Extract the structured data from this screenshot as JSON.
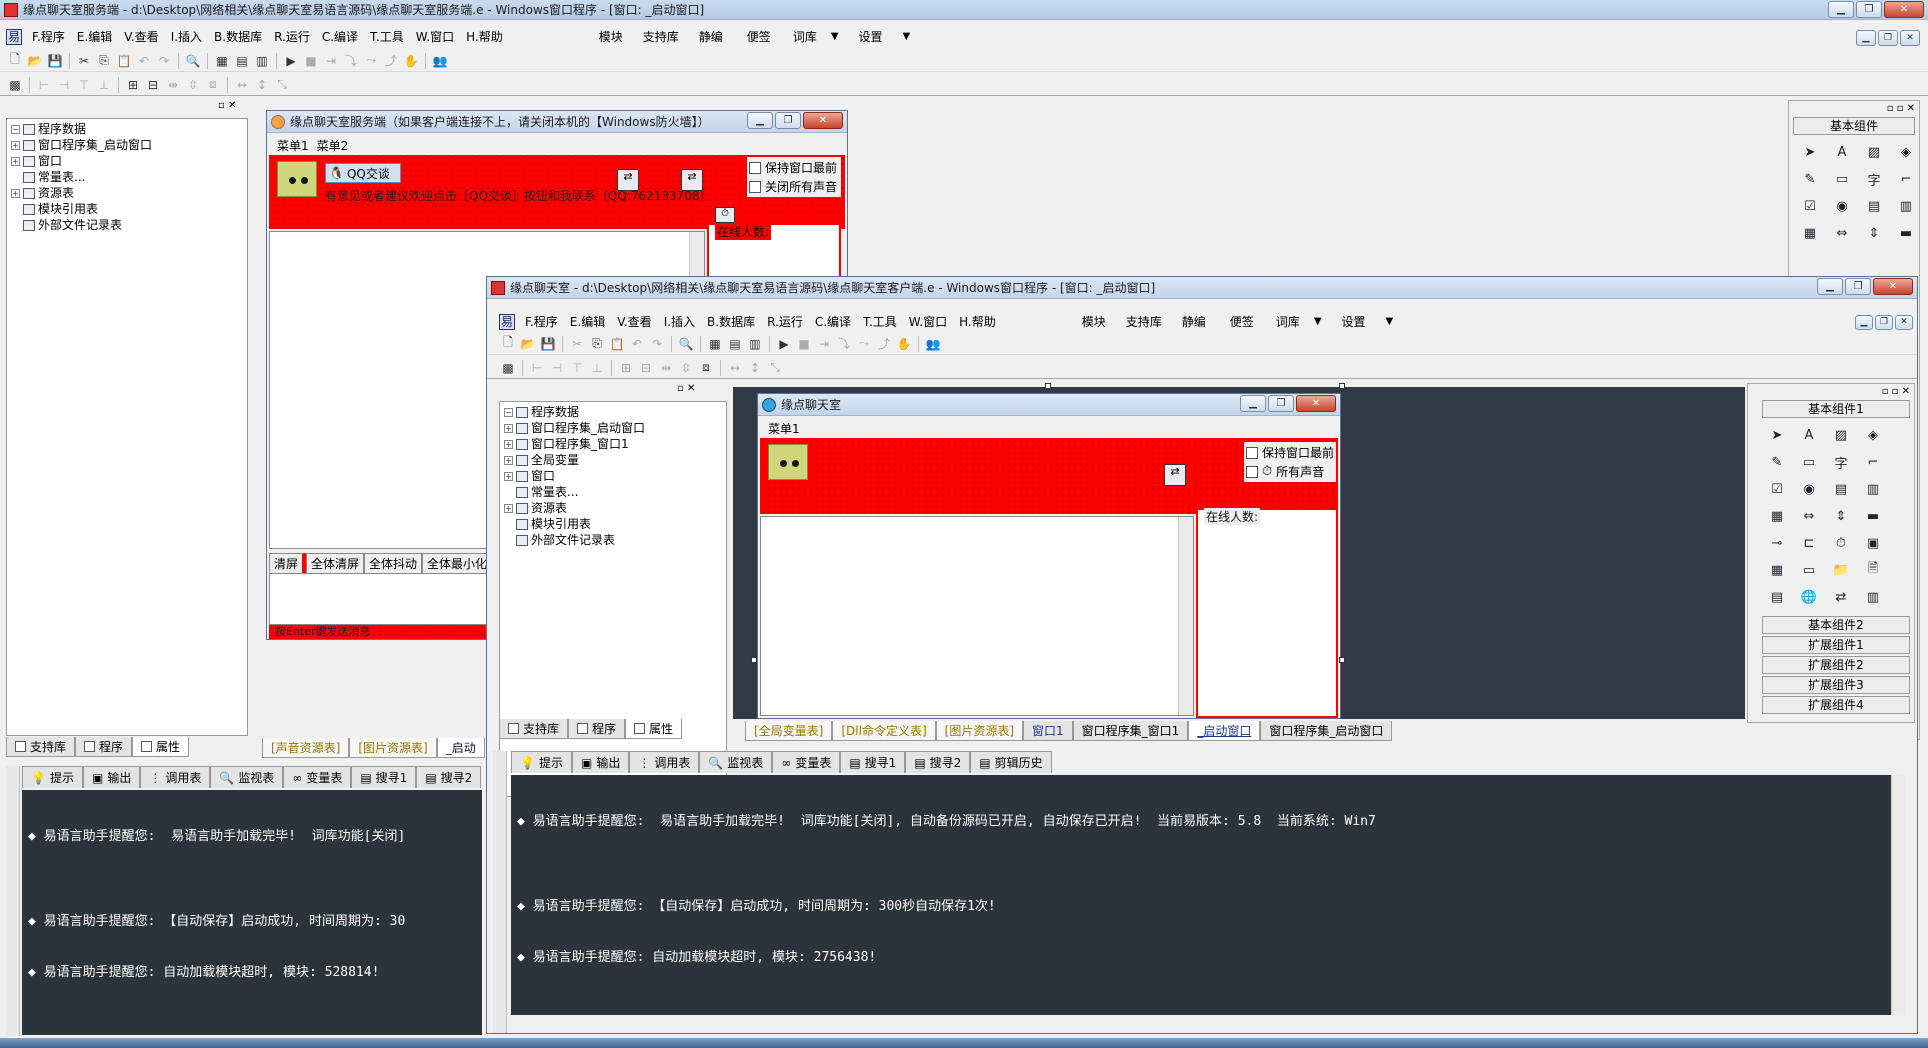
{
  "main_window": {
    "title": "缘点聊天室服务端 - d:\\Desktop\\网络相关\\缘点聊天室易语言源码\\缘点聊天室服务端.e - Windows窗口程序 - [窗口: _启动窗口]",
    "menu": [
      {
        "label": "F.程序"
      },
      {
        "label": "E.编辑"
      },
      {
        "label": "V.查看"
      },
      {
        "label": "I.插入"
      },
      {
        "label": "B.数据库"
      },
      {
        "label": "R.运行"
      },
      {
        "label": "C.编译"
      },
      {
        "label": "T.工具"
      },
      {
        "label": "W.窗口"
      },
      {
        "label": "H.帮助"
      }
    ],
    "menu_extra": [
      {
        "label": "模块"
      },
      {
        "label": "支持库"
      },
      {
        "label": "静编"
      },
      {
        "label": "便签"
      },
      {
        "label": "词库"
      },
      {
        "label": "▼"
      },
      {
        "label": "设置"
      },
      {
        "label": "▼"
      }
    ],
    "tree": [
      {
        "label": "程序数据",
        "level": 0,
        "expander": "−"
      },
      {
        "label": "窗口程序集_启动窗口",
        "level": 1,
        "expander": "+"
      },
      {
        "label": "窗口",
        "level": 1,
        "expander": "+"
      },
      {
        "label": "常量表...",
        "level": 1,
        "expander": ""
      },
      {
        "label": "资源表",
        "level": 1,
        "expander": "+"
      },
      {
        "label": "模块引用表",
        "level": 1,
        "expander": ""
      },
      {
        "label": "外部文件记录表",
        "level": 1,
        "expander": ""
      }
    ],
    "left_tabs": [
      {
        "label": "支持库"
      },
      {
        "label": "程序"
      },
      {
        "label": "属性"
      }
    ],
    "editor_tabs": [
      {
        "label": "[声音资源表]"
      },
      {
        "label": "[图片资源表]"
      },
      {
        "label": "_启动"
      }
    ],
    "output_tabs": [
      {
        "label": "提示"
      },
      {
        "label": "输出"
      },
      {
        "label": "调用表"
      },
      {
        "label": "监视表"
      },
      {
        "label": "变量表"
      },
      {
        "label": "搜寻1"
      },
      {
        "label": "搜寻2"
      }
    ],
    "output_lines": [
      "◆ 易语言助手提醒您:  易语言助手加载完毕!  词库功能[关闭]",
      "",
      "◆ 易语言助手提醒您: 【自动保存】启动成功, 时间周期为: 30",
      "◆ 易语言助手提醒您: 自动加载模块超时, 模块: 528814!"
    ],
    "right_panel": {
      "header": "基本组件",
      "buttons": []
    }
  },
  "server_form": {
    "title": "缘点聊天室服务端（如果客户端连接不上，请关闭本机的【Windows防火墙】）",
    "menu": [
      {
        "label": "菜单1"
      },
      {
        "label": "菜单2"
      }
    ],
    "qq_button": "QQ交谈",
    "notice": "有意见或者建议欢迎点击［QQ交谈］按钮和我联系（QQ:762133708）",
    "check_keep_front": "保持窗口最前",
    "check_mute": "关闭所有声音",
    "online_label": "在线人数:",
    "bottom_buttons": [
      {
        "label": "清屏"
      },
      {
        "label": "全体清屏"
      },
      {
        "label": "全体抖动"
      },
      {
        "label": "全体最小化"
      }
    ],
    "hint": "按Enter键发送消息"
  },
  "client_window": {
    "title": "缘点聊天室 - d:\\Desktop\\网络相关\\缘点聊天室易语言源码\\缘点聊天室客户端.e - Windows窗口程序 - [窗口: _启动窗口]",
    "menu": [
      {
        "label": "F.程序"
      },
      {
        "label": "E.编辑"
      },
      {
        "label": "V.查看"
      },
      {
        "label": "I.插入"
      },
      {
        "label": "B.数据库"
      },
      {
        "label": "R.运行"
      },
      {
        "label": "C.编译"
      },
      {
        "label": "T.工具"
      },
      {
        "label": "W.窗口"
      },
      {
        "label": "H.帮助"
      }
    ],
    "menu_extra": [
      {
        "label": "模块"
      },
      {
        "label": "支持库"
      },
      {
        "label": "静编"
      },
      {
        "label": "便签"
      },
      {
        "label": "词库"
      },
      {
        "label": "▼"
      },
      {
        "label": "设置"
      },
      {
        "label": "▼"
      }
    ],
    "tree": [
      {
        "label": "程序数据",
        "level": 0,
        "expander": "−"
      },
      {
        "label": "窗口程序集_启动窗口",
        "level": 1,
        "expander": "+"
      },
      {
        "label": "窗口程序集_窗口1",
        "level": 1,
        "expander": "+"
      },
      {
        "label": "全局变量",
        "level": 1,
        "expander": "+"
      },
      {
        "label": "窗口",
        "level": 1,
        "expander": "+"
      },
      {
        "label": "常量表...",
        "level": 1,
        "expander": ""
      },
      {
        "label": "资源表",
        "level": 1,
        "expander": "+"
      },
      {
        "label": "模块引用表",
        "level": 1,
        "expander": ""
      },
      {
        "label": "外部文件记录表",
        "level": 1,
        "expander": ""
      }
    ],
    "left_tabs": [
      {
        "label": "支持库"
      },
      {
        "label": "程序"
      },
      {
        "label": "属性"
      }
    ],
    "editor_tabs": [
      {
        "label": "[全局变量表]"
      },
      {
        "label": "[Dll命令定义表]"
      },
      {
        "label": "[图片资源表]"
      },
      {
        "label": "窗口1"
      },
      {
        "label": "窗口程序集_窗口1"
      },
      {
        "label": "_启动窗口"
      },
      {
        "label": "窗口程序集_启动窗口"
      }
    ],
    "output_tabs": [
      {
        "label": "提示"
      },
      {
        "label": "输出"
      },
      {
        "label": "调用表"
      },
      {
        "label": "监视表"
      },
      {
        "label": "变量表"
      },
      {
        "label": "搜寻1"
      },
      {
        "label": "搜寻2"
      },
      {
        "label": "剪辑历史"
      }
    ],
    "output_lines": [
      "◆ 易语言助手提醒您:  易语言助手加载完毕!  词库功能[关闭], 自动备份源码已开启, 自动保存已开启!  当前易版本: 5.8  当前系统: Win7",
      "",
      "◆ 易语言助手提醒您: 【自动保存】启动成功, 时间周期为: 300秒自动保存1次!",
      "◆ 易语言助手提醒您: 自动加载模块超时, 模块: 2756438!"
    ],
    "right_panel": {
      "header": "基本组件1",
      "buttons": [
        {
          "label": "基本组件2"
        },
        {
          "label": "扩展组件1"
        },
        {
          "label": "扩展组件2"
        },
        {
          "label": "扩展组件3"
        },
        {
          "label": "扩展组件4"
        }
      ]
    }
  },
  "client_form": {
    "title": "缘点聊天室",
    "menu": [
      {
        "label": "菜单1"
      }
    ],
    "check_keep_front": "保持窗口最前",
    "check_mute": "所有声音",
    "online_label": "在线人数:"
  },
  "colors": {
    "form_red": "#ff0000",
    "ide_dark": "#2f3a44",
    "face_yellow": "#cfd77a"
  }
}
